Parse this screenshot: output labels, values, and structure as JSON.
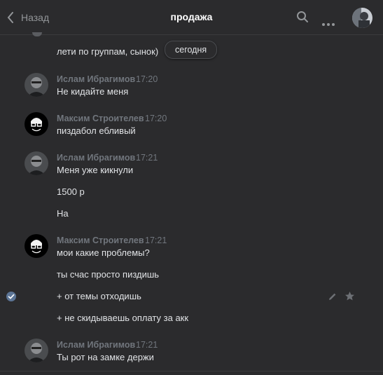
{
  "header": {
    "back_label": "Назад",
    "title": "продажа"
  },
  "date_pill": "сегодня",
  "messages": [
    {
      "text": "лети по группам, сынок)"
    },
    {
      "name": "Ислам Ибрагимов",
      "time": "17:20",
      "lines": [
        "Не кидайте меня"
      ]
    },
    {
      "name": "Максим Строителев",
      "time": "17:20",
      "lines": [
        "пиздабол ебливый"
      ]
    },
    {
      "name": "Ислам Ибрагимов",
      "time": "17:21",
      "lines": [
        "Меня уже кикнули",
        "1500 р",
        "На"
      ]
    },
    {
      "name": "Максим Строителев",
      "time": "17:21",
      "lines": [
        "мои какие проблемы?",
        "ты счас просто пиздишь",
        "+ от темы отходишь",
        "+ не скидываешь оплату за акк"
      ]
    },
    {
      "name": "Ислам Ибрагимов",
      "time": "17:21",
      "lines": [
        "Ты рот на замке держи"
      ]
    }
  ],
  "icons": {
    "back": "chevron-left-icon",
    "search": "search-icon",
    "more": "more-icon",
    "selected": "check-icon",
    "edit": "pencil-icon",
    "favorite": "star-icon"
  },
  "colors": {
    "background": "#2b2b2d",
    "text": "#e1e3e6",
    "secondary": "#71767d",
    "accent": "#5c7596"
  }
}
